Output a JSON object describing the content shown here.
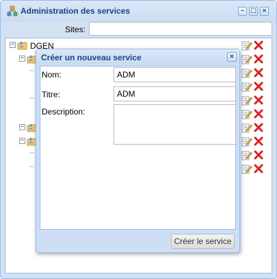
{
  "window": {
    "title": "Administration des services",
    "icon": "org-chart-icon",
    "tools": [
      "minimize-icon",
      "maximize-icon",
      "close-icon"
    ]
  },
  "sites": {
    "label": "Sites:",
    "value": ""
  },
  "tree": {
    "root": {
      "label": "DGEN",
      "expanded": true
    },
    "row_actions": [
      "edit-icon",
      "delete-icon"
    ]
  },
  "dialog": {
    "title": "Créer un nouveau service",
    "fields": {
      "nom_label": "Nom:",
      "nom_value": "ADM",
      "titre_label": "Titre:",
      "titre_value": "ADM",
      "description_label": "Description:",
      "description_value": ""
    },
    "submit_label": "Créer le service"
  },
  "colors": {
    "title_text": "#15428b",
    "frame": "#d3e1f1",
    "border": "#99bbe8",
    "delete_red": "#e02020"
  }
}
